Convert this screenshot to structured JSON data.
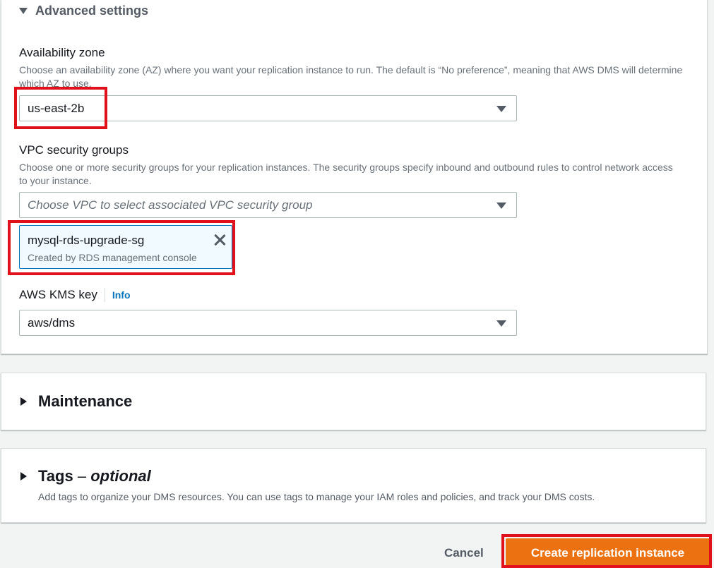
{
  "advanced": {
    "title": "Advanced settings"
  },
  "availability_zone": {
    "label": "Availability zone",
    "description": "Choose an availability zone (AZ) where you want your replication instance to run. The default is “No preference”, meaning that AWS DMS will determine which AZ to use.",
    "value": "us-east-2b"
  },
  "vpc_security_groups": {
    "label": "VPC security groups",
    "description": "Choose one or more security groups for your replication instances. The security groups specify inbound and outbound rules to control network access to your instance.",
    "placeholder": "Choose VPC to select associated VPC security group",
    "selected": {
      "name": "mysql-rds-upgrade-sg",
      "description": "Created by RDS management console"
    }
  },
  "kms": {
    "label": "AWS KMS key",
    "info": "Info",
    "value": "aws/dms"
  },
  "maintenance": {
    "title": "Maintenance"
  },
  "tags": {
    "title": "Tags",
    "dash": " – ",
    "optional": "optional",
    "description": "Add tags to organize your DMS resources. You can use tags to manage your IAM roles and policies, and track your DMS costs."
  },
  "actions": {
    "cancel": "Cancel",
    "create": "Create replication instance"
  },
  "colors": {
    "highlight": "#e0111b",
    "primary": "#ec7211",
    "link": "#0073bb"
  }
}
